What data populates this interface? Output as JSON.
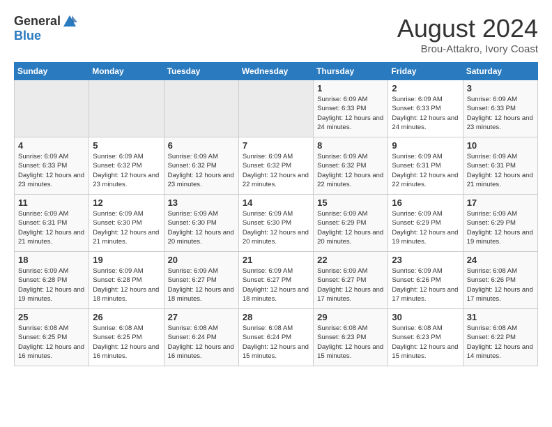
{
  "logo": {
    "line1": "General",
    "line2": "Blue"
  },
  "title": "August 2024",
  "location": "Brou-Attakro, Ivory Coast",
  "weekdays": [
    "Sunday",
    "Monday",
    "Tuesday",
    "Wednesday",
    "Thursday",
    "Friday",
    "Saturday"
  ],
  "weeks": [
    [
      {
        "day": "",
        "info": ""
      },
      {
        "day": "",
        "info": ""
      },
      {
        "day": "",
        "info": ""
      },
      {
        "day": "",
        "info": ""
      },
      {
        "day": "1",
        "info": "Sunrise: 6:09 AM\nSunset: 6:33 PM\nDaylight: 12 hours\nand 24 minutes."
      },
      {
        "day": "2",
        "info": "Sunrise: 6:09 AM\nSunset: 6:33 PM\nDaylight: 12 hours\nand 24 minutes."
      },
      {
        "day": "3",
        "info": "Sunrise: 6:09 AM\nSunset: 6:33 PM\nDaylight: 12 hours\nand 23 minutes."
      }
    ],
    [
      {
        "day": "4",
        "info": "Sunrise: 6:09 AM\nSunset: 6:33 PM\nDaylight: 12 hours\nand 23 minutes."
      },
      {
        "day": "5",
        "info": "Sunrise: 6:09 AM\nSunset: 6:32 PM\nDaylight: 12 hours\nand 23 minutes."
      },
      {
        "day": "6",
        "info": "Sunrise: 6:09 AM\nSunset: 6:32 PM\nDaylight: 12 hours\nand 23 minutes."
      },
      {
        "day": "7",
        "info": "Sunrise: 6:09 AM\nSunset: 6:32 PM\nDaylight: 12 hours\nand 22 minutes."
      },
      {
        "day": "8",
        "info": "Sunrise: 6:09 AM\nSunset: 6:32 PM\nDaylight: 12 hours\nand 22 minutes."
      },
      {
        "day": "9",
        "info": "Sunrise: 6:09 AM\nSunset: 6:31 PM\nDaylight: 12 hours\nand 22 minutes."
      },
      {
        "day": "10",
        "info": "Sunrise: 6:09 AM\nSunset: 6:31 PM\nDaylight: 12 hours\nand 21 minutes."
      }
    ],
    [
      {
        "day": "11",
        "info": "Sunrise: 6:09 AM\nSunset: 6:31 PM\nDaylight: 12 hours\nand 21 minutes."
      },
      {
        "day": "12",
        "info": "Sunrise: 6:09 AM\nSunset: 6:30 PM\nDaylight: 12 hours\nand 21 minutes."
      },
      {
        "day": "13",
        "info": "Sunrise: 6:09 AM\nSunset: 6:30 PM\nDaylight: 12 hours\nand 20 minutes."
      },
      {
        "day": "14",
        "info": "Sunrise: 6:09 AM\nSunset: 6:30 PM\nDaylight: 12 hours\nand 20 minutes."
      },
      {
        "day": "15",
        "info": "Sunrise: 6:09 AM\nSunset: 6:29 PM\nDaylight: 12 hours\nand 20 minutes."
      },
      {
        "day": "16",
        "info": "Sunrise: 6:09 AM\nSunset: 6:29 PM\nDaylight: 12 hours\nand 19 minutes."
      },
      {
        "day": "17",
        "info": "Sunrise: 6:09 AM\nSunset: 6:29 PM\nDaylight: 12 hours\nand 19 minutes."
      }
    ],
    [
      {
        "day": "18",
        "info": "Sunrise: 6:09 AM\nSunset: 6:28 PM\nDaylight: 12 hours\nand 19 minutes."
      },
      {
        "day": "19",
        "info": "Sunrise: 6:09 AM\nSunset: 6:28 PM\nDaylight: 12 hours\nand 18 minutes."
      },
      {
        "day": "20",
        "info": "Sunrise: 6:09 AM\nSunset: 6:27 PM\nDaylight: 12 hours\nand 18 minutes."
      },
      {
        "day": "21",
        "info": "Sunrise: 6:09 AM\nSunset: 6:27 PM\nDaylight: 12 hours\nand 18 minutes."
      },
      {
        "day": "22",
        "info": "Sunrise: 6:09 AM\nSunset: 6:27 PM\nDaylight: 12 hours\nand 17 minutes."
      },
      {
        "day": "23",
        "info": "Sunrise: 6:09 AM\nSunset: 6:26 PM\nDaylight: 12 hours\nand 17 minutes."
      },
      {
        "day": "24",
        "info": "Sunrise: 6:08 AM\nSunset: 6:26 PM\nDaylight: 12 hours\nand 17 minutes."
      }
    ],
    [
      {
        "day": "25",
        "info": "Sunrise: 6:08 AM\nSunset: 6:25 PM\nDaylight: 12 hours\nand 16 minutes."
      },
      {
        "day": "26",
        "info": "Sunrise: 6:08 AM\nSunset: 6:25 PM\nDaylight: 12 hours\nand 16 minutes."
      },
      {
        "day": "27",
        "info": "Sunrise: 6:08 AM\nSunset: 6:24 PM\nDaylight: 12 hours\nand 16 minutes."
      },
      {
        "day": "28",
        "info": "Sunrise: 6:08 AM\nSunset: 6:24 PM\nDaylight: 12 hours\nand 15 minutes."
      },
      {
        "day": "29",
        "info": "Sunrise: 6:08 AM\nSunset: 6:23 PM\nDaylight: 12 hours\nand 15 minutes."
      },
      {
        "day": "30",
        "info": "Sunrise: 6:08 AM\nSunset: 6:23 PM\nDaylight: 12 hours\nand 15 minutes."
      },
      {
        "day": "31",
        "info": "Sunrise: 6:08 AM\nSunset: 6:22 PM\nDaylight: 12 hours\nand 14 minutes."
      }
    ]
  ]
}
